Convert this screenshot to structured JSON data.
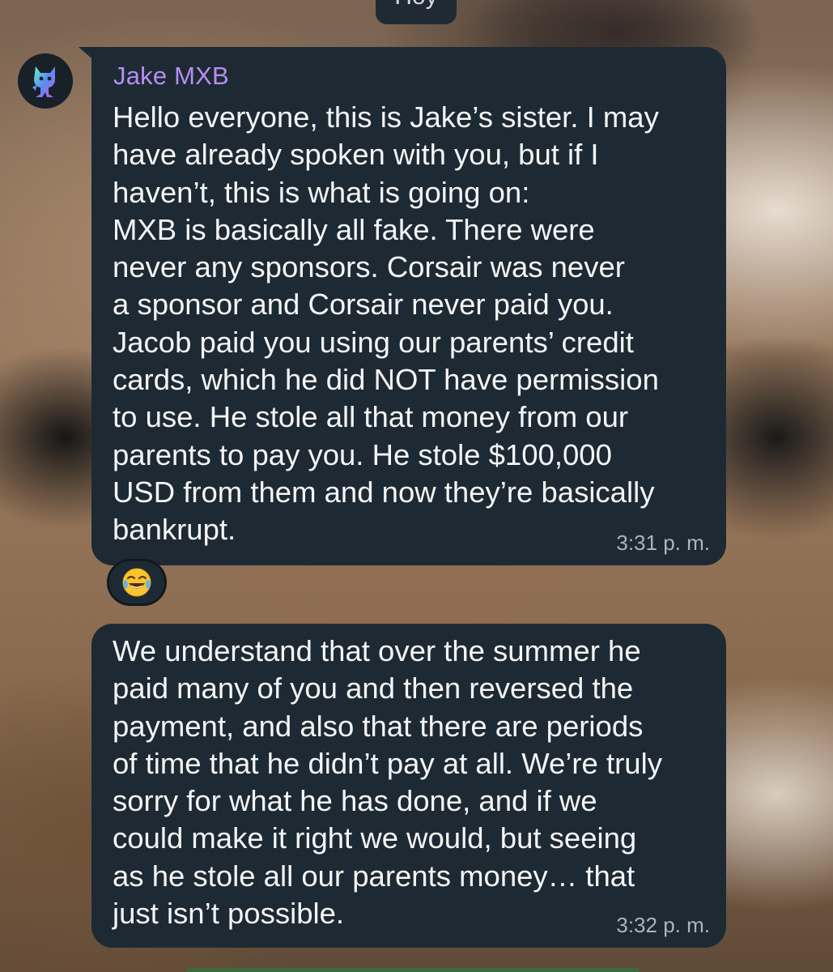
{
  "date_chip": {
    "label": "Hoy"
  },
  "messages": [
    {
      "sender": "Jake MXB",
      "text": "Hello everyone, this is Jake’s sister. I may\nhave already spoken with you, but if I\nhaven’t, this is what is going on:\nMXB is basically all fake. There were\nnever any sponsors. Corsair was never\na sponsor and Corsair never paid you.\nJacob paid you using our parents’ credit\ncards, which he did NOT have permission\nto use. He stole all that money from our\nparents to pay you. He stole $100,000\nUSD from them and now they’re basically\nbankrupt.",
      "time": "3:31 p. m.",
      "reaction": "😂"
    },
    {
      "text": "We understand that over the summer he\npaid many of you and then reversed the\npayment, and also that there are periods\nof time that he didn’t pay at all. We’re truly\nsorry for what he has done, and if we\ncould make it right we would, but seeing\nas he stole all our parents money… that\njust isn’t possible.",
      "time": "3:32 p. m."
    }
  ],
  "icons": {
    "avatar": "monstercat-logo-icon",
    "reaction": "face-with-tears-of-joy-icon"
  },
  "colors": {
    "bubble": "#1e2a33",
    "sender_name": "#b58ef2",
    "time": "#a9b4bc",
    "text": "#f3f5f6"
  }
}
